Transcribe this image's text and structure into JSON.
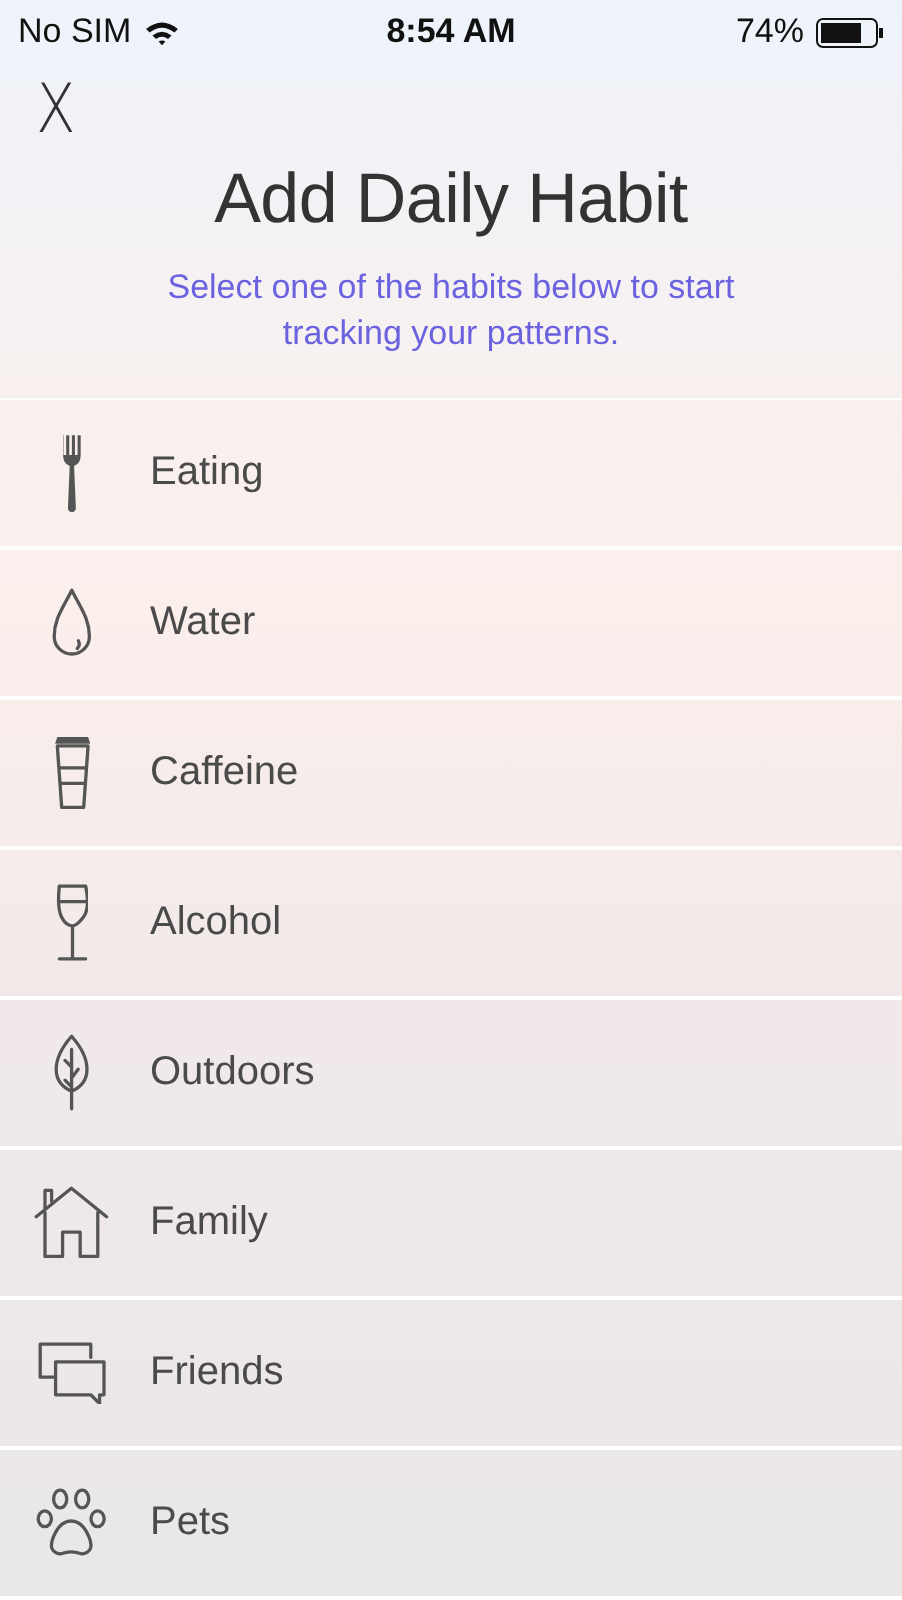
{
  "status_bar": {
    "carrier": "No SIM",
    "time": "8:54 AM",
    "battery": "74%"
  },
  "header": {
    "close": "X",
    "title": "Add Daily Habit",
    "subtitle": "Select one of the habits below to start tracking your patterns."
  },
  "habits": [
    {
      "label": "Eating",
      "kind": "fork"
    },
    {
      "label": "Water",
      "kind": "drop"
    },
    {
      "label": "Caffeine",
      "kind": "cup"
    },
    {
      "label": "Alcohol",
      "kind": "glass"
    },
    {
      "label": "Outdoors",
      "kind": "leaf"
    },
    {
      "label": "Family",
      "kind": "house"
    },
    {
      "label": "Friends",
      "kind": "chat"
    },
    {
      "label": "Pets",
      "kind": "paw"
    }
  ]
}
